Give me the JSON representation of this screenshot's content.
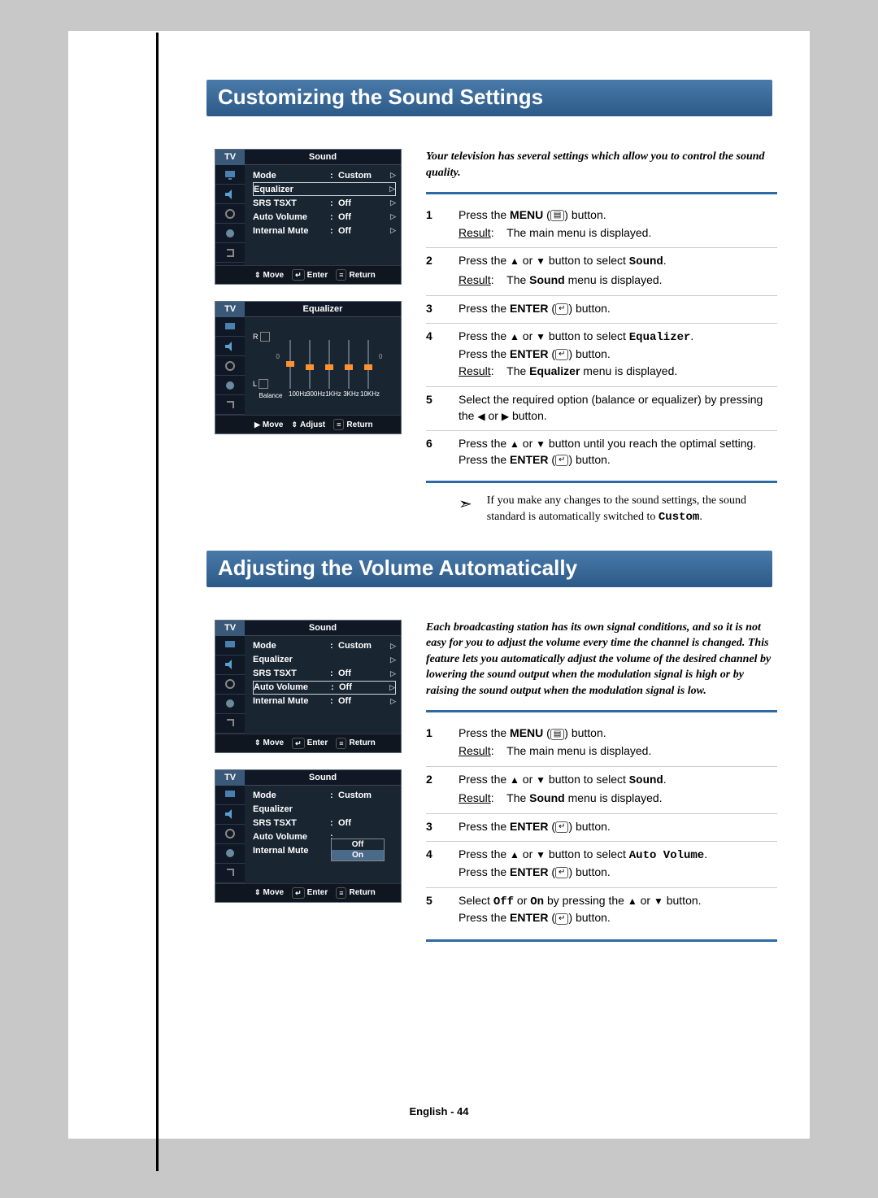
{
  "section1_title": "Customizing the Sound Settings",
  "section2_title": "Adjusting the Volume Automatically",
  "intro1": "Your television has several settings which allow you to control the sound quality.",
  "intro2": "Each broadcasting station has its own signal conditions, and so it is not easy for you to adjust the volume every time the channel  is changed. This feature lets you automatically adjust the volume of the desired channel by lowering the sound output when the modulation signal is high or by raising the sound output when the modulation signal is low.",
  "osd": {
    "tv": "TV",
    "title_sound": "Sound",
    "title_eq": "Equalizer",
    "rows": [
      {
        "label": "Mode",
        "val": "Custom"
      },
      {
        "label": "Equalizer",
        "val": ""
      },
      {
        "label": "SRS TSXT",
        "val": "Off"
      },
      {
        "label": "Auto Volume",
        "val": "Off"
      },
      {
        "label": "Internal Mute",
        "val": "Off"
      }
    ],
    "move": "Move",
    "enter": "Enter",
    "return": "Return",
    "adjust": "Adjust",
    "eq_bands": [
      "100Hz",
      "300Hz",
      "1KHz",
      "3KHz",
      "10KHz"
    ],
    "balance": "Balance",
    "R": "R",
    "L": "L",
    "popup": {
      "off": "Off",
      "on": "On"
    }
  },
  "steps1": [
    {
      "n": "1",
      "html": "Press the <b>MENU</b> (<span class='btn-icon'>&#9636;</span>) button.",
      "res": "The main menu is displayed."
    },
    {
      "n": "2",
      "html": "Press the <span class='tri'>▲</span> or <span class='tri'>▼</span> button to select <span class='mono'>Sound</span>.",
      "res": "The <b>Sound</b> menu is displayed."
    },
    {
      "n": "3",
      "html": "Press the <b>ENTER</b> (<span class='btn-icon'>↵</span>) button."
    },
    {
      "n": "4",
      "html": "Press the <span class='tri'>▲</span> or <span class='tri'>▼</span> button to select <span class='mono'>Equalizer</span>.<br>Press the <b>ENTER</b> (<span class='btn-icon'>↵</span>) button.",
      "res": "The <b>Equalizer</b> menu is displayed."
    },
    {
      "n": "5",
      "html": "Select the required option (balance or equalizer) by pressing the <span class='tri'>◀</span> or <span class='tri'>▶</span> button."
    },
    {
      "n": "6",
      "html": "Press the <span class='tri'>▲</span> or <span class='tri'>▼</span> button until you reach the optimal setting.<br>Press the <b>ENTER</b> (<span class='btn-icon'>↵</span>) button."
    }
  ],
  "note1": "If you make any changes to the sound settings, the sound standard is automatically switched to ",
  "note1_mono": "Custom",
  "steps2": [
    {
      "n": "1",
      "html": "Press the <b>MENU</b> (<span class='btn-icon'>&#9636;</span>) button.",
      "res": "The main menu is displayed."
    },
    {
      "n": "2",
      "html": "Press the <span class='tri'>▲</span> or <span class='tri'>▼</span> button to select <span class='mono'>Sound</span>.",
      "res": "The <b>Sound</b> menu is displayed."
    },
    {
      "n": "3",
      "html": "Press the <b>ENTER</b> (<span class='btn-icon'>↵</span>) button."
    },
    {
      "n": "4",
      "html": "Press the <span class='tri'>▲</span> or <span class='tri'>▼</span> button to select <span class='mono'>Auto Volume</span>.<br>Press the <b>ENTER</b> (<span class='btn-icon'>↵</span>) button."
    },
    {
      "n": "5",
      "html": "Select <span class='mono'>Off</span> or <span class='mono'>On</span> by pressing the <span class='tri'>▲</span> or <span class='tri'>▼</span> button.<br>Press the <b>ENTER</b> (<span class='btn-icon'>↵</span>) button."
    }
  ],
  "footer": "English - 44"
}
